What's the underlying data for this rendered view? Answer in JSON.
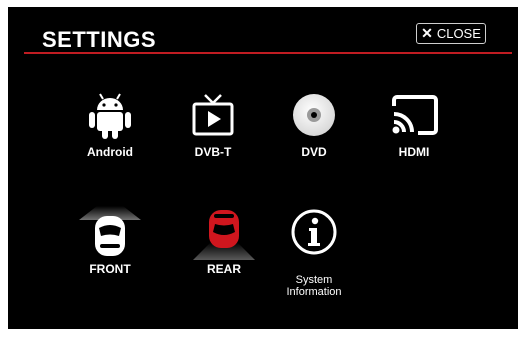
{
  "header": {
    "title": "SETTINGS",
    "close_label": "CLOSE"
  },
  "colors": {
    "background": "#000000",
    "accent": "#c01c22",
    "text": "#ffffff"
  },
  "tiles": [
    {
      "label": "Android",
      "icon": "android-icon"
    },
    {
      "label": "DVB-T",
      "icon": "tv-icon"
    },
    {
      "label": "DVD",
      "icon": "disc-icon"
    },
    {
      "label": "HDMI",
      "icon": "cast-icon"
    },
    {
      "label": "FRONT",
      "icon": "car-front-icon"
    },
    {
      "label": "REAR",
      "icon": "car-rear-icon"
    },
    {
      "label": "System\nInformation",
      "icon": "info-icon"
    }
  ]
}
